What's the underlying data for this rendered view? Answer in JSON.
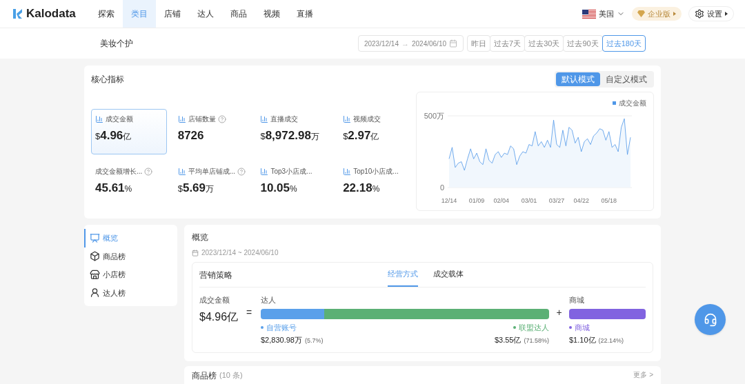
{
  "nav": {
    "logo": "Kalodata",
    "items": [
      {
        "label": "探索",
        "selected": false
      },
      {
        "label": "类目",
        "selected": true
      },
      {
        "label": "店铺",
        "selected": false
      },
      {
        "label": "达人",
        "selected": false
      },
      {
        "label": "商品",
        "selected": false
      },
      {
        "label": "视频",
        "selected": false
      },
      {
        "label": "直播",
        "selected": false
      }
    ],
    "region": "美国",
    "plan": "企业版",
    "settings": "设置"
  },
  "subbar": {
    "category": "美妆个护",
    "date_start": "2023/12/14",
    "date_arrow": "→",
    "date_end": "2024/06/10",
    "ranges": [
      {
        "label": "昨日",
        "selected": false
      },
      {
        "label": "过去7天",
        "selected": false
      },
      {
        "label": "过去30天",
        "selected": false
      },
      {
        "label": "过去90天",
        "selected": false
      },
      {
        "label": "过去180天",
        "selected": true
      }
    ]
  },
  "core": {
    "title": "核心指标",
    "modes": [
      {
        "label": "默认模式",
        "selected": true
      },
      {
        "label": "自定义模式",
        "selected": false
      }
    ],
    "metrics": [
      {
        "label": "成交金额",
        "prefix": "$",
        "value": "4.96",
        "unit": "亿",
        "selected": true,
        "chart_icon": true,
        "help": false
      },
      {
        "label": "店铺数量",
        "value": "8726",
        "selected": false,
        "chart_icon": true,
        "help": true
      },
      {
        "label": "直播成交",
        "prefix": "$",
        "value": "8,972.98",
        "unit": "万",
        "selected": false,
        "chart_icon": true,
        "help": false
      },
      {
        "label": "视频成交",
        "prefix": "$",
        "value": "2.97",
        "unit": "亿",
        "selected": false,
        "chart_icon": true,
        "help": false
      },
      {
        "label": "成交金额增长...",
        "value": "45.61",
        "unit": "%",
        "selected": false,
        "chart_icon": false,
        "help": true
      },
      {
        "label": "平均单店铺成...",
        "prefix": "$",
        "value": "5.69",
        "unit": "万",
        "selected": false,
        "chart_icon": true,
        "help": true
      },
      {
        "label": "Top3小店成...",
        "value": "10.05",
        "unit": "%",
        "selected": false,
        "chart_icon": true,
        "help": false
      },
      {
        "label": "Top10小店成...",
        "value": "22.18",
        "unit": "%",
        "selected": false,
        "chart_icon": true,
        "help": false
      }
    ],
    "chart_data": {
      "type": "area",
      "yticks": [
        {
          "value": 0,
          "label": "0"
        },
        {
          "value": 500,
          "label": "500万"
        }
      ],
      "ylim": [
        0,
        500
      ],
      "categories": [
        "12/14",
        null,
        null,
        null,
        null,
        null,
        null,
        null,
        null,
        "01/09",
        null,
        null,
        null,
        null,
        null,
        null,
        null,
        "02/04",
        null,
        null,
        null,
        null,
        null,
        null,
        null,
        null,
        "03/01",
        null,
        null,
        null,
        null,
        null,
        null,
        null,
        null,
        "03/27",
        null,
        null,
        null,
        null,
        null,
        null,
        null,
        "04/22",
        null,
        null,
        null,
        null,
        null,
        null,
        null,
        null,
        "05/18",
        null,
        null,
        null,
        null,
        null,
        null,
        null
      ],
      "series": [
        {
          "name": "成交金额",
          "color": "#4f97e8",
          "values": [
            200,
            280,
            140,
            170,
            180,
            120,
            200,
            270,
            200,
            240,
            180,
            160,
            270,
            190,
            170,
            230,
            250,
            210,
            240,
            230,
            290,
            270,
            160,
            220,
            250,
            240,
            300,
            290,
            390,
            290,
            320,
            280,
            330,
            280,
            470,
            300,
            280,
            400,
            290,
            420,
            400,
            310,
            350,
            250,
            320,
            340,
            300,
            360,
            380,
            410,
            400,
            330,
            390,
            280,
            300,
            250,
            420,
            480,
            230,
            350
          ]
        }
      ]
    }
  },
  "side_menu": [
    {
      "label": "概览",
      "selected": true
    },
    {
      "label": "商品榜",
      "selected": false
    },
    {
      "label": "小店榜",
      "selected": false
    },
    {
      "label": "达人榜",
      "selected": false
    }
  ],
  "overview": {
    "title": "概览",
    "date_range": "2023/12/14 ~ 2024/06/10",
    "strategy": {
      "title": "营销策略",
      "tabs": [
        {
          "label": "经营方式",
          "selected": true
        },
        {
          "label": "成交载体",
          "selected": false
        }
      ],
      "total_label": "成交金额",
      "total": "$4.96亿",
      "equals": "=",
      "plus": "+",
      "creator": {
        "label": "达人",
        "segments": [
          {
            "name": "自营账号",
            "value": "$2,830.98万",
            "share": "(5.7%)",
            "level": 0.22,
            "color": "#5aa0ea"
          },
          {
            "name": "联盟达人",
            "value": "$3.55亿",
            "share": "(71.58%)",
            "level": 0.78,
            "color": "#5bb075"
          }
        ]
      },
      "mall": {
        "label": "商城",
        "name": "商城",
        "value": "$1.10亿",
        "share": "(22.14%)",
        "level": 1,
        "color": "#8163e0"
      }
    }
  },
  "next_card": {
    "title": "商品榜",
    "count": "(10 条)",
    "more": "更多 >"
  }
}
